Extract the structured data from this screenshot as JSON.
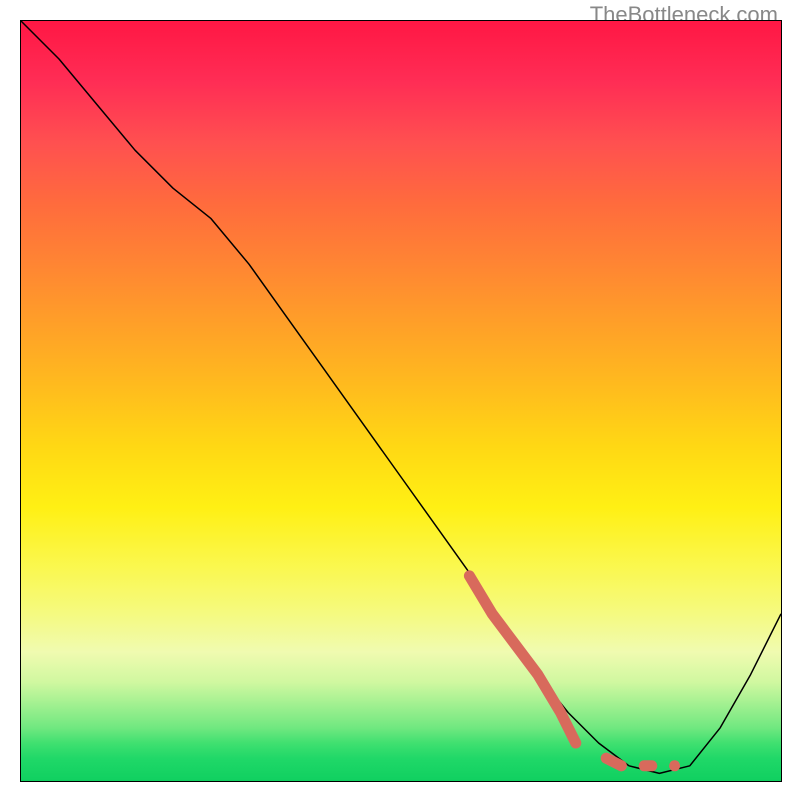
{
  "watermark": "TheBottleneck.com",
  "chart_data": {
    "type": "line",
    "title": "",
    "xlabel": "",
    "ylabel": "",
    "xlim": [
      0,
      100
    ],
    "ylim": [
      0,
      100
    ],
    "grid": false,
    "axis_ticks": false,
    "series": [
      {
        "name": "bottleneck-curve",
        "color": "#000000",
        "stroke_width": 1.5,
        "x": [
          0,
          5,
          10,
          15,
          20,
          25,
          30,
          35,
          40,
          45,
          50,
          55,
          60,
          62,
          65,
          68,
          72,
          76,
          80,
          84,
          88,
          92,
          96,
          100
        ],
        "y": [
          100,
          95,
          89,
          83,
          78,
          74,
          68,
          61,
          54,
          47,
          40,
          33,
          26,
          22,
          18,
          14,
          9,
          5,
          2,
          1,
          2,
          7,
          14,
          22
        ]
      },
      {
        "name": "highlighted-segment",
        "color": "#d86a5c",
        "stroke_width": 11,
        "style": "solid-then-dashed",
        "x": [
          59,
          62,
          65,
          68,
          71,
          73,
          77,
          79,
          82,
          83,
          86
        ],
        "y": [
          27,
          22,
          18,
          14,
          9,
          5,
          3,
          2,
          2,
          2,
          2
        ]
      }
    ],
    "background_gradient": {
      "type": "vertical",
      "stops": [
        {
          "pos": 0.0,
          "color": "#ff1744"
        },
        {
          "pos": 0.5,
          "color": "#ffd814"
        },
        {
          "pos": 0.8,
          "color": "#f5fa80"
        },
        {
          "pos": 1.0,
          "color": "#10d060"
        }
      ]
    }
  }
}
